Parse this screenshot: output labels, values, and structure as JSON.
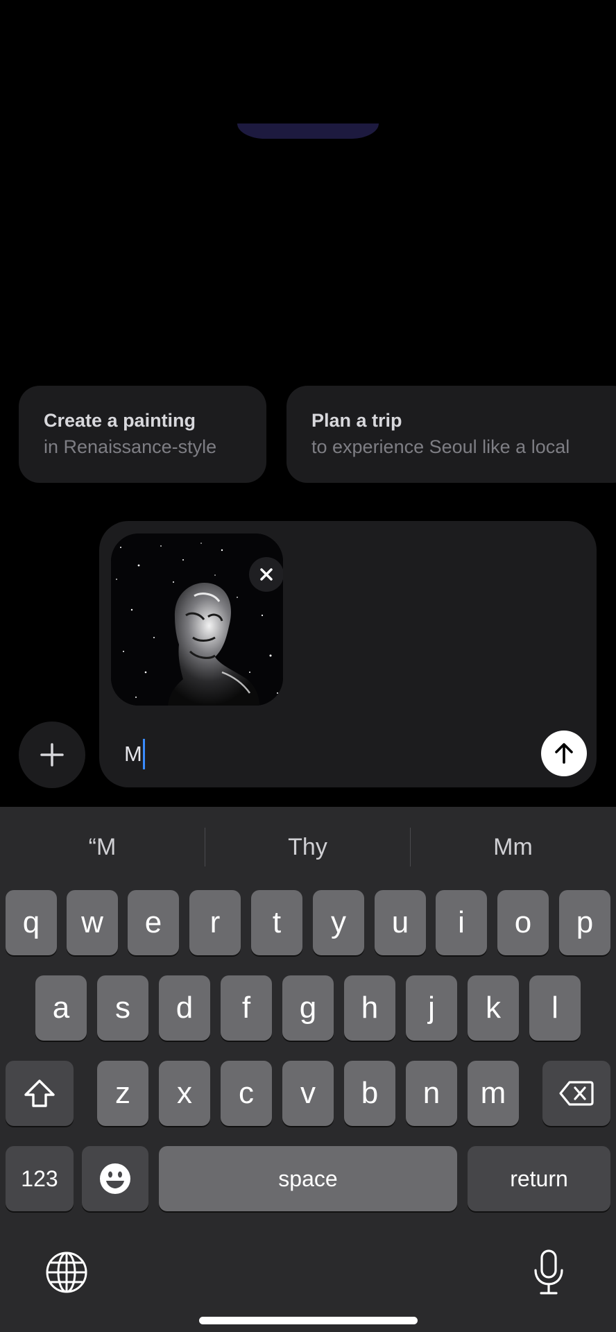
{
  "suggestions": [
    {
      "title": "Create a painting",
      "subtitle": "in Renaissance-style"
    },
    {
      "title": "Plan a trip",
      "subtitle": "to experience Seoul like a local"
    }
  ],
  "composer": {
    "text": "M",
    "attachment_icon": "image-thumbnail",
    "remove_icon": "close-icon",
    "send_icon": "arrow-up-icon"
  },
  "plus_icon": "plus-icon",
  "keyboard": {
    "predictions": [
      "“M",
      "Thy",
      "Mm"
    ],
    "row1": [
      "q",
      "w",
      "e",
      "r",
      "t",
      "y",
      "u",
      "i",
      "o",
      "p"
    ],
    "row2": [
      "a",
      "s",
      "d",
      "f",
      "g",
      "h",
      "j",
      "k",
      "l"
    ],
    "row3": [
      "z",
      "x",
      "c",
      "v",
      "b",
      "n",
      "m"
    ],
    "numbers_label": "123",
    "space_label": "space",
    "return_label": "return",
    "icons": [
      "shift-icon",
      "backspace-icon",
      "emoji-icon",
      "globe-icon",
      "microphone-icon"
    ]
  },
  "colors": {
    "background": "#000000",
    "card": "#1c1c1e",
    "keyboard": "#2a2a2c",
    "caret": "#3a8bff"
  }
}
